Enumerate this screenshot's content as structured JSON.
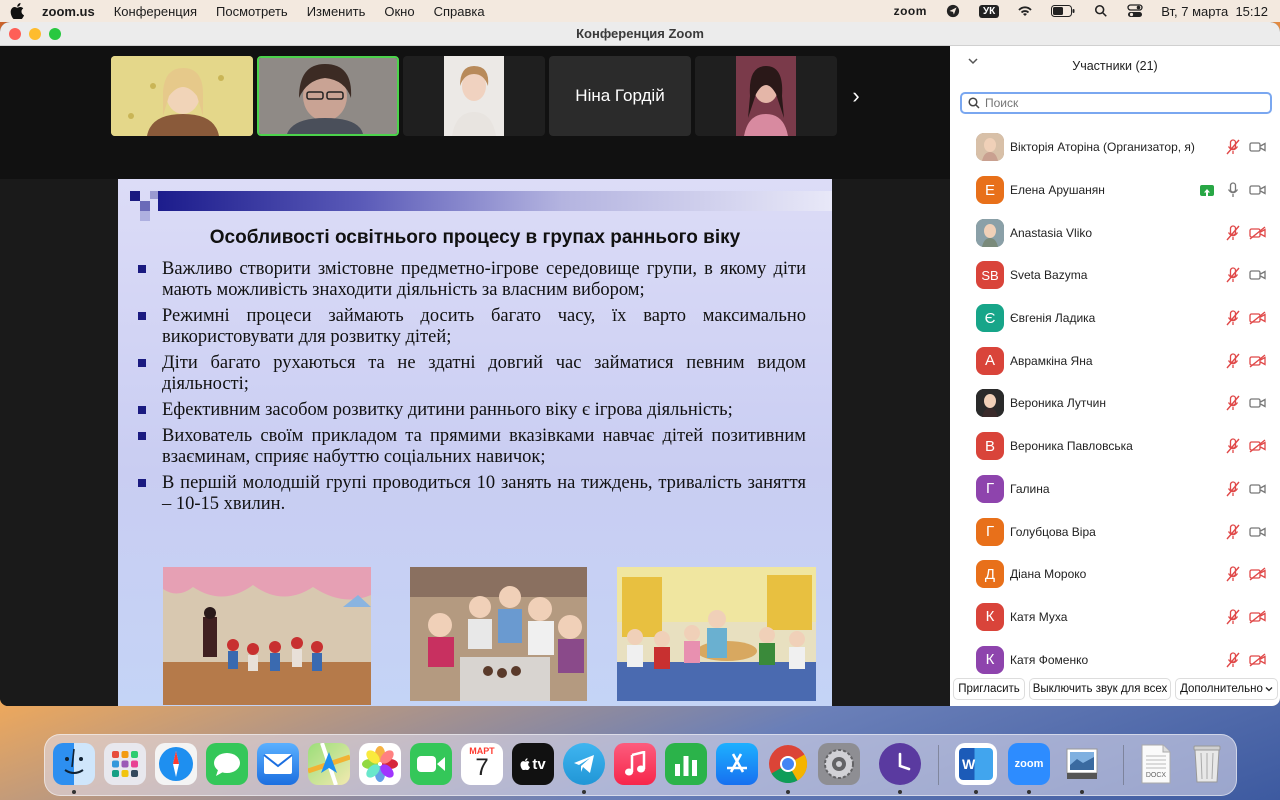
{
  "menubar": {
    "app": "zoom.us",
    "items": [
      "Конференция",
      "Посмотреть",
      "Изменить",
      "Окно",
      "Справка"
    ],
    "status_app": "zoom",
    "keyboard_layout": "УК",
    "datetime": "Вт, 7 марта  15:12"
  },
  "window": {
    "title": "Конференция Zoom"
  },
  "gallery": {
    "tiles": [
      {
        "type": "video"
      },
      {
        "type": "video",
        "active": true
      },
      {
        "type": "video"
      },
      {
        "type": "name",
        "name": "Ніна Гордій"
      },
      {
        "type": "video"
      }
    ]
  },
  "slide": {
    "title": "Особливості освітнього процесу в групах раннього віку",
    "bullets": [
      "Важливо створити змістовне предметно-ігрове середовище групи, в якому діти мають можливість знаходити діяльність за власним вибором;",
      "Режимні процеси займають досить багато часу, їх варто максимально використовувати для розвитку дітей;",
      "Діти багато рухаються та не здатні довгий час займатися певним видом діяльності;",
      "Ефективним засобом розвитку дитини раннього віку є ігрова діяльність;",
      "Вихователь своїм прикладом та  прямими вказівками навчає дітей позитивним взаєминам, сприяє набуттю соціальних навичок;",
      "В першій молодшій групі проводиться 10 занять на тиждень, тривалість заняття – 10-15 хвилин."
    ]
  },
  "participants": {
    "title": "Участники (21)",
    "search_placeholder": "Поиск",
    "list": [
      {
        "name": "Вікторія Аторіна (Организатор, я)",
        "initial": "",
        "color": "#9b8a7a",
        "photo": true,
        "mic": "muted",
        "cam": "on",
        "share": false
      },
      {
        "name": "Елена Арушанян",
        "initial": "Е",
        "color": "#e8701a",
        "photo": false,
        "mic": "on",
        "cam": "on",
        "share": true
      },
      {
        "name": "Anastasia Vliko",
        "initial": "",
        "color": "#6b7a6a",
        "photo": true,
        "mic": "muted",
        "cam": "off",
        "share": false
      },
      {
        "name": "Sveta Bazyma",
        "initial": "SB",
        "color": "#d9443a",
        "photo": false,
        "mic": "muted",
        "cam": "on",
        "share": false
      },
      {
        "name": "Євгенія Ладика",
        "initial": "Є",
        "color": "#17a589",
        "photo": false,
        "mic": "muted",
        "cam": "off",
        "share": false
      },
      {
        "name": "Аврамкіна Яна",
        "initial": "А",
        "color": "#d9443a",
        "photo": false,
        "mic": "muted",
        "cam": "off",
        "share": false
      },
      {
        "name": "Вероника Лутчин",
        "initial": "",
        "color": "#2b2b2b",
        "photo": true,
        "mic": "muted",
        "cam": "on",
        "share": false
      },
      {
        "name": "Вероника Павловська",
        "initial": "В",
        "color": "#d9443a",
        "photo": false,
        "mic": "muted",
        "cam": "off",
        "share": false
      },
      {
        "name": "Галина",
        "initial": "Г",
        "color": "#8e44ad",
        "photo": false,
        "mic": "muted",
        "cam": "on",
        "share": false
      },
      {
        "name": "Голубцова Віра",
        "initial": "Г",
        "color": "#e8701a",
        "photo": false,
        "mic": "muted",
        "cam": "on",
        "share": false
      },
      {
        "name": "Діана Мороко",
        "initial": "Д",
        "color": "#e8701a",
        "photo": false,
        "mic": "muted",
        "cam": "off",
        "share": false
      },
      {
        "name": "Катя Муха",
        "initial": "К",
        "color": "#d9443a",
        "photo": false,
        "mic": "muted",
        "cam": "off",
        "share": false
      },
      {
        "name": "Катя Фоменко",
        "initial": "К",
        "color": "#8e44ad",
        "photo": false,
        "mic": "muted",
        "cam": "off",
        "share": false
      }
    ],
    "footer": {
      "invite": "Пригласить",
      "mute_all": "Выключить звук для всех",
      "more": "Дополнительно"
    }
  },
  "dock": {
    "calendar_month": "МАРТ",
    "calendar_day": "7",
    "tv_label": "tv",
    "zoom_label": "zoom",
    "word_label": "W",
    "doc_label": "DOCX",
    "apps": [
      "finder-icon",
      "launchpad-icon",
      "safari-icon",
      "messages-icon",
      "mail-icon",
      "maps-icon",
      "photos-icon",
      "facetime-icon",
      "calendar-icon",
      "apple-tv-icon",
      "telegram-icon",
      "music-icon",
      "numbers-icon",
      "app-store-icon",
      "chrome-icon",
      "system-settings-icon",
      "clock-icon",
      "word-icon",
      "zoom-icon",
      "preview-icon",
      "document-icon",
      "trash-icon"
    ]
  }
}
